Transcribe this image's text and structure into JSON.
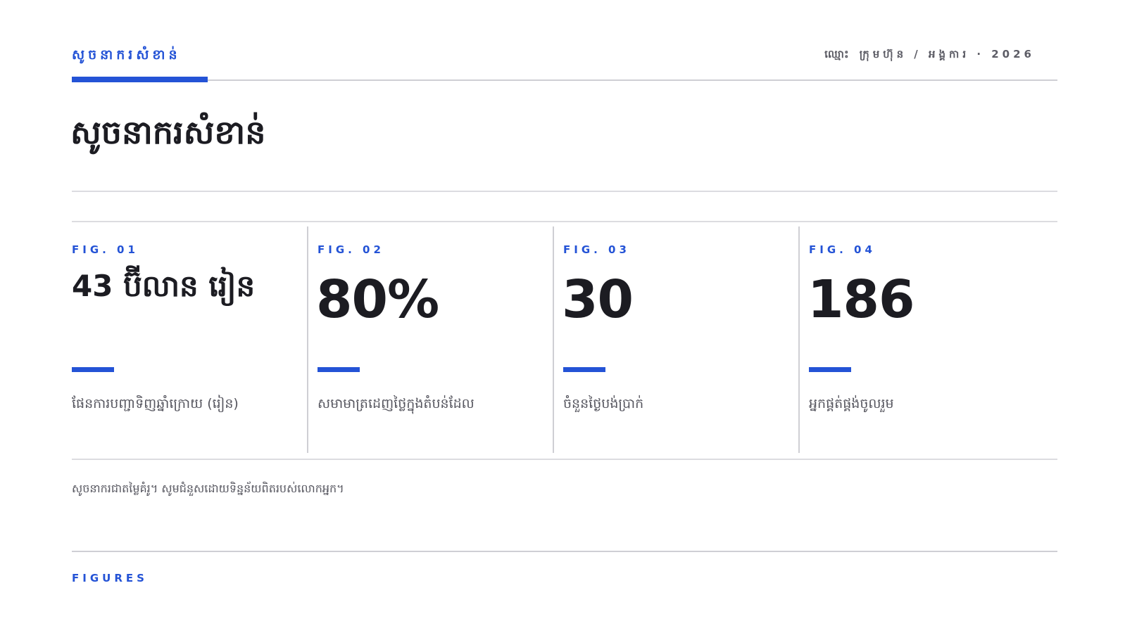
{
  "header": {
    "kicker": "សូចនាករសំខាន់",
    "meta": "ឈ្មោះ ក្រុមហ៊ុន / អង្គការ · 2026"
  },
  "title": "សូចនាករសំខាន់",
  "figures": [
    {
      "label": "FIG. 01",
      "value": "43 ប៊ីលាន រៀន",
      "description": "ផែនការបញ្ជាទិញឆ្នាំក្រោយ (រៀន)"
    },
    {
      "label": "FIG. 02",
      "value": "80%",
      "description": "សមាមាត្រដេញថ្លៃក្នុងតំបន់ដែល"
    },
    {
      "label": "FIG. 03",
      "value": "30",
      "description": "ចំនួនថ្ងៃបង់ប្រាក់"
    },
    {
      "label": "FIG. 04",
      "value": "186",
      "description": "អ្នកផ្គត់ផ្គង់ចូលរួម"
    }
  ],
  "note": "សូចនាករជាតម្លៃគំរូ។ សូមជំនួសដោយទិន្នន័យពិតរបស់លោកអ្នក។",
  "footer": {
    "label": "FIGURES"
  },
  "colors": {
    "accent": "#2453d6",
    "text": "#1c1c22",
    "muted": "#55555e",
    "rule": "#dcdce0"
  }
}
